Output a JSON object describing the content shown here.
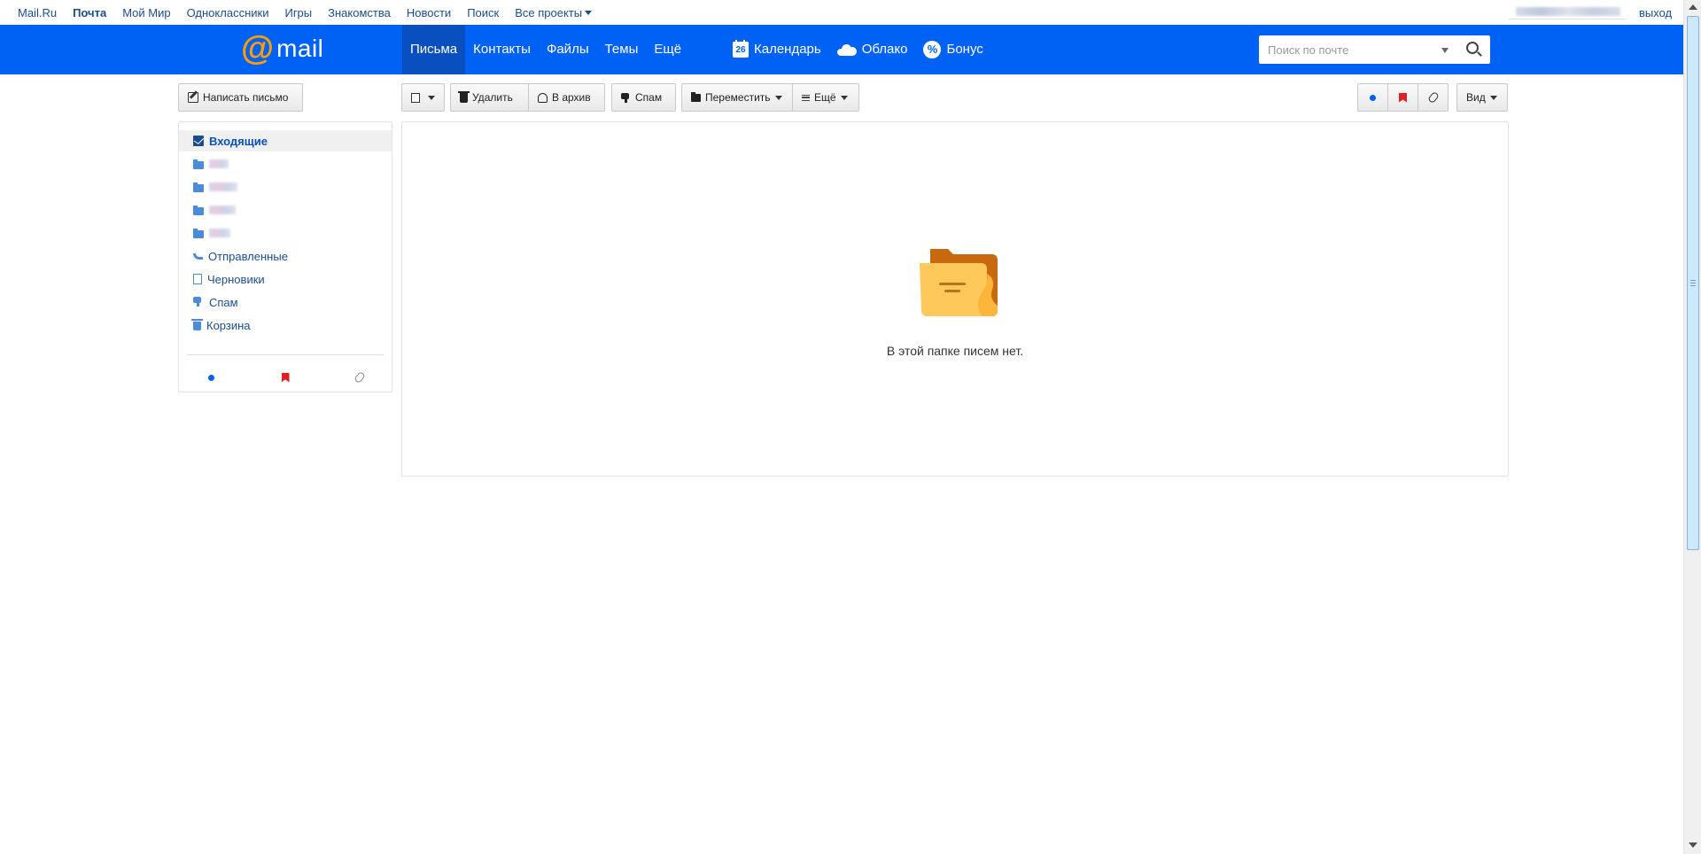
{
  "portal": {
    "links": [
      {
        "label": "Mail.Ru",
        "active": false
      },
      {
        "label": "Почта",
        "active": true
      },
      {
        "label": "Мой Мир",
        "active": false
      },
      {
        "label": "Одноклассники",
        "active": false
      },
      {
        "label": "Игры",
        "active": false
      },
      {
        "label": "Знакомства",
        "active": false
      },
      {
        "label": "Новости",
        "active": false
      },
      {
        "label": "Поиск",
        "active": false
      }
    ],
    "all_projects": "Все проекты",
    "logout": "выход"
  },
  "header": {
    "logo_at": "@",
    "logo_word": "mail",
    "nav": [
      "Письма",
      "Контакты",
      "Файлы",
      "Темы",
      "Ещё"
    ],
    "calendar_day": "26",
    "calendar": "Календарь",
    "cloud": "Облако",
    "bonus_glyph": "%",
    "bonus": "Бонус",
    "search_placeholder": "Поиск по почте"
  },
  "toolbar": {
    "compose": "Написать письмо",
    "delete": "Удалить",
    "archive": "В архив",
    "spam": "Спам",
    "move": "Переместить",
    "more": "Ещё",
    "view": "Вид"
  },
  "sidebar": {
    "inbox": "Входящие",
    "sent": "Отправленные",
    "drafts": "Черновики",
    "spam": "Спам",
    "trash": "Корзина"
  },
  "main": {
    "empty_text": "В этой папке писем нет."
  },
  "colors": {
    "header_blue": "#0062f5",
    "logo_orange": "#ff9e00",
    "link_blue": "#1a4d8f",
    "flag_red": "#e31e24"
  }
}
